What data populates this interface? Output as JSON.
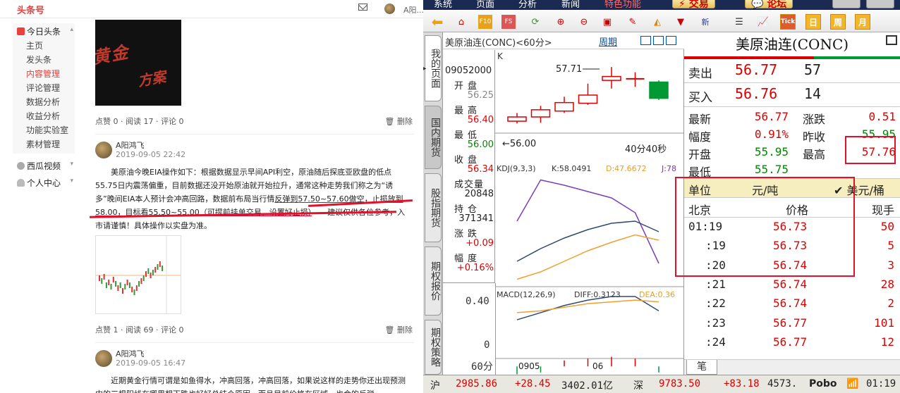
{
  "toutiao": {
    "logo": "头条号",
    "user": "A阳...",
    "sidebar": {
      "group1": "今日头条",
      "items": [
        "主页",
        "发头条",
        "内容管理",
        "评论管理",
        "数据分析",
        "收益分析",
        "功能实验室",
        "素材管理"
      ],
      "group2": "西瓜视频",
      "group3": "个人中心"
    },
    "post1": {
      "stats": "点赞 0 · 阅读 17 · 评论 0",
      "delete": "删除"
    },
    "post2": {
      "author": "A阳鸿飞",
      "time": "2019-09-05 22:42",
      "text_a": "美原油今晚EIA操作如下：根据数据显示早间API利空，原油随后探底亚欧盘的低点55.75日内震荡偏重，目前数据还没开始原油就开始拉升，通常这种走势我们称之为“诱多”晚间EIA本人预计会冲高回路，数据前布局当行情",
      "text_b": "反弹到57.50~57.60做空，止损放到58.00，目标看55.50~55.00（可提前挂单交易，设置好止损）",
      "text_c": "　　建议仅供各位参考，入市请谨慎！具体操作以实盘为准。",
      "stats": "点赞 1 · 阅读 69 · 评论 0",
      "delete": "删除"
    },
    "post3": {
      "author": "A阳鸿飞",
      "time": "2019-09-05 16:47",
      "text": "近期黄金行情可谓是如鱼得水，冲高回落，冲高回落，如果说这样的走势你还出现预测中的三根阳线在哪里想下跌也好好总结个原因，而且目前价格在区域，也会的反弹"
    }
  },
  "terminal": {
    "menu": [
      "系统",
      "页面",
      "分析",
      "新闻",
      "特色功能"
    ],
    "trade_btn": "交易",
    "forum_btn": "论坛",
    "toolbar_boxes": [
      "Tick",
      "日",
      "周",
      "月"
    ],
    "vtabs": [
      "我的页面",
      "国内期货",
      "股指期货",
      "期权报价",
      "期权策略"
    ],
    "chart_header": {
      "name": "美原油连(CONC)<60分>",
      "period": "周期"
    },
    "info": [
      {
        "label": "",
        "value": "09052000",
        "color": "#222"
      },
      {
        "label": "开盘",
        "value": "56.25",
        "color": "#888"
      },
      {
        "label": "最高",
        "value": "56.40",
        "color": "#d00"
      },
      {
        "label": "最低",
        "value": "56.00",
        "color": "#080"
      },
      {
        "label": "收盘",
        "value": "56.34",
        "color": "#d00"
      },
      {
        "label": "成交量",
        "value": "20848",
        "color": "#222"
      },
      {
        "label": "持仓",
        "value": "371341",
        "color": "#222"
      },
      {
        "label": "涨跌",
        "value": "+0.09",
        "color": "#d00"
      },
      {
        "label": "幅度",
        "value": "+0.16%",
        "color": "#d00"
      }
    ],
    "chart": {
      "k_label": "K",
      "high_label": "57.71",
      "low_label": "56.00",
      "countdown": "40分40秒",
      "kdj_label": "KDJ(9,3,3)",
      "kdj_k": "K:58.0491",
      "kdj_d": "D:47.6672",
      "kdj_j": "J:78",
      "macd_label": "MACD(12,26,9)",
      "macd_diff": "DIFF:0.3123",
      "macd_dea": "DEA:0.36",
      "macd_tick_high": "0.40",
      "macd_tick_zero": "0",
      "x_labels": [
        "60分",
        "0905",
        "06"
      ]
    },
    "chart_data": {
      "type": "candlestick",
      "candles": [
        {
          "open": 56.05,
          "close": 56.18,
          "high": 56.3,
          "low": 55.98
        },
        {
          "open": 56.18,
          "close": 56.4,
          "high": 56.52,
          "low": 56.0
        },
        {
          "open": 56.36,
          "close": 56.62,
          "high": 56.8,
          "low": 56.3
        },
        {
          "open": 56.6,
          "close": 56.85,
          "high": 57.2,
          "low": 56.55
        },
        {
          "open": 57.3,
          "close": 57.42,
          "high": 57.71,
          "low": 57.05
        },
        {
          "open": 57.35,
          "close": 57.35,
          "high": 57.55,
          "low": 57.1
        },
        {
          "open": 57.25,
          "close": 56.75,
          "high": 57.3,
          "low": 56.7
        }
      ],
      "price_range": [
        55.9,
        57.8
      ],
      "kdj": {
        "K": [
          58,
          97,
          92,
          86,
          80,
          66,
          18
        ],
        "D": [
          20,
          32,
          42,
          50,
          56,
          58,
          48
        ],
        "J": [
          3,
          10,
          20,
          30,
          38,
          45,
          40
        ]
      },
      "kdj_range": [
        0,
        100
      ],
      "macd": {
        "DIFF": [
          0.26,
          0.3,
          0.34,
          0.37,
          0.39,
          0.39,
          0.31
        ],
        "DEA": [
          0.3,
          0.31,
          0.33,
          0.35,
          0.36,
          0.37,
          0.36
        ],
        "hist": [
          -0.02,
          -0.01,
          0.01,
          0.02,
          0.03,
          0.02,
          -0.01
        ]
      },
      "macd_range": [
        -0.05,
        0.5
      ]
    },
    "quote": {
      "title": "美原油连(CONC)",
      "sell_label": "卖出",
      "sell_price": "56.77",
      "sell_vol": "57",
      "buy_label": "买入",
      "buy_price": "56.76",
      "buy_vol": "14",
      "rows": [
        {
          "l1": "最新",
          "v1": "56.77",
          "c1": "#d00",
          "l2": "涨跌",
          "v2": "0.51",
          "c2": "#d00"
        },
        {
          "l1": "幅度",
          "v1": "0.91%",
          "c1": "#d00",
          "l2": "昨收",
          "v2": "55.95",
          "c2": "#080"
        },
        {
          "l1": "开盘",
          "v1": "55.95",
          "c1": "#080",
          "l2": "最高",
          "v2": "57.76",
          "c2": "#d00"
        },
        {
          "l1": "最低",
          "v1": "55.75",
          "c1": "#080",
          "l2": "",
          "v2": "",
          "c2": "#222"
        }
      ],
      "unit_label": "单位",
      "unit_value": "元/吨",
      "unit_check": "美元/桶",
      "ticks_header": {
        "time": "北京",
        "price": "价格",
        "vol": "现手"
      },
      "ticks": [
        {
          "time": "01:19",
          "price": "56.73",
          "vol": "50"
        },
        {
          "time": ":19",
          "price": "56.73",
          "vol": "5"
        },
        {
          "time": ":20",
          "price": "56.74",
          "vol": "3"
        },
        {
          "time": ":21",
          "price": "56.74",
          "vol": "28"
        },
        {
          "time": ":22",
          "price": "56.74",
          "vol": "2"
        },
        {
          "time": ":23",
          "price": "56.77",
          "vol": "101"
        },
        {
          "time": ":24",
          "price": "56.77",
          "vol": "12"
        }
      ],
      "tab": "笔"
    },
    "status": {
      "sh_label": "沪",
      "sh_val": "2985.86",
      "sh_chg": "+28.45",
      "sh_amt": "3402.01亿",
      "sz_label": "深",
      "sz_val": "9783.50",
      "sz_chg": "+83.18",
      "sz_amt": "4573.",
      "brand": "Pobo",
      "time": "01:19"
    }
  }
}
